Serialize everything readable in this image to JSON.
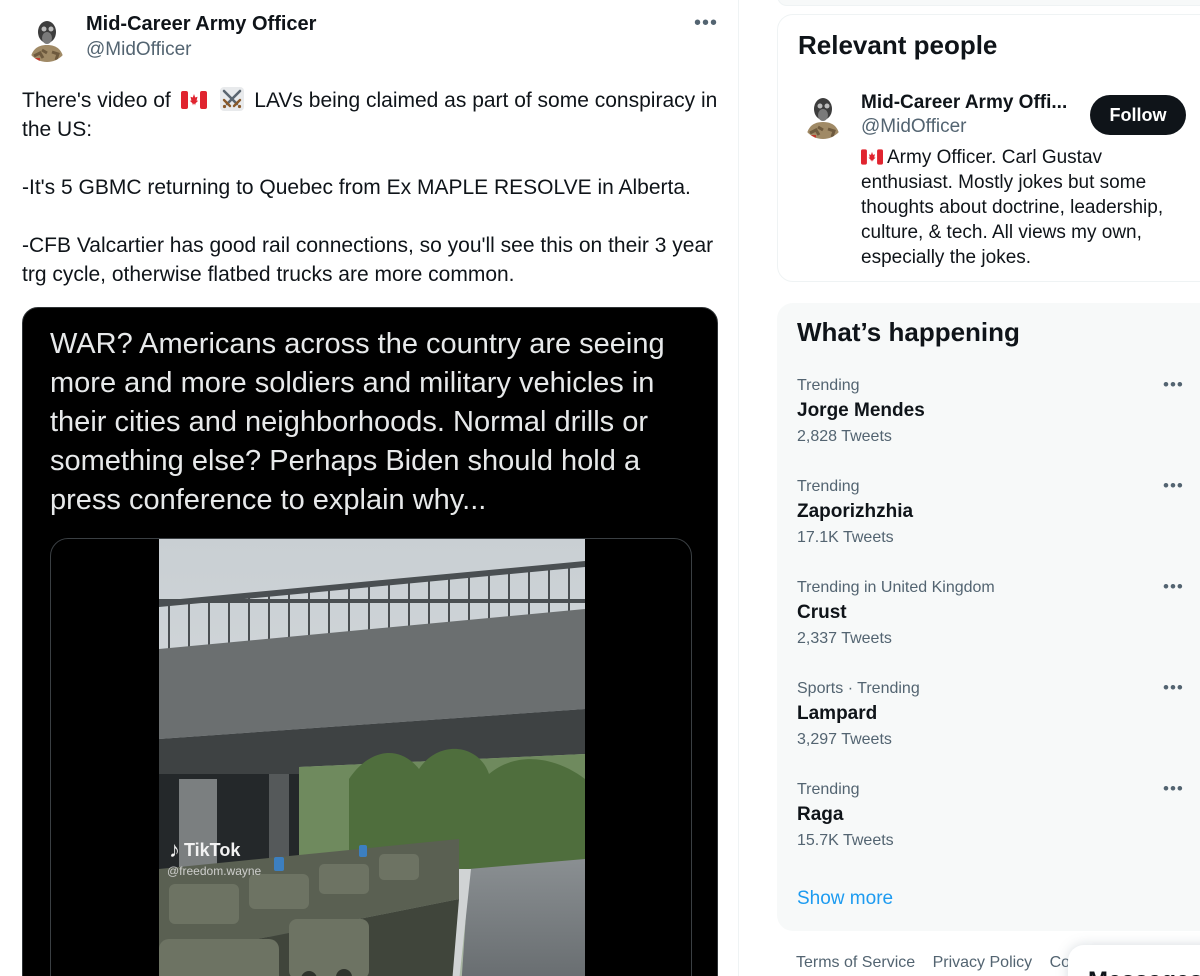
{
  "tweet": {
    "author_name": "Mid-Career Army Officer",
    "author_handle": "@MidOfficer",
    "more_label": "•••",
    "text_before_emoji": "There's video of",
    "text_after_emoji": "LAVs being claimed as part of some conspiracy in the US:",
    "paragraph_2": "-It's 5 GBMC returning to Quebec from Ex MAPLE RESOLVE in Alberta.",
    "paragraph_3": "-CFB Valcartier has good rail connections, so you'll see this on their 3 year trg cycle, otherwise flatbed trucks are more common.",
    "emojis": [
      "canada-flag",
      "crossed-swords"
    ],
    "media": {
      "caption": "WAR? Americans across the country are seeing more and more soldiers and military vehicles in their cities and neighborhoods. Normal drills or something else? Perhaps Biden should hold a press conference to explain why...",
      "video_watermark": "TikTok",
      "video_user": "@freedom.wayne"
    }
  },
  "relevant_people": {
    "title": "Relevant people",
    "person": {
      "name": "Mid-Career Army Offi...",
      "handle": "@MidOfficer",
      "follow_label": "Follow",
      "bio": "Army Officer. Carl Gustav enthusiast. Mostly jokes but some thoughts about doctrine, leadership, culture, & tech. All views my own, especially the jokes."
    }
  },
  "whats_happening": {
    "title": "What’s happening",
    "trends": [
      {
        "context": "Trending",
        "name": "Jorge Mendes",
        "count": "2,828 Tweets"
      },
      {
        "context": "Trending",
        "name": "Zaporizhzhia",
        "count": "17.1K Tweets"
      },
      {
        "context": "Trending in United Kingdom",
        "name": "Crust",
        "count": "2,337 Tweets"
      },
      {
        "context": "Sports · Trending",
        "name": "Lampard",
        "count": "3,297 Tweets"
      },
      {
        "context": "Trending",
        "name": "Raga",
        "count": "15.7K Tweets"
      }
    ],
    "more_label": "•••",
    "show_more": "Show more"
  },
  "footer": {
    "links": [
      "Terms of Service",
      "Privacy Policy",
      "Co"
    ]
  },
  "messages": {
    "title": "Messages"
  },
  "colors": {
    "accent": "#1d9bf0",
    "text_primary": "#0f1419",
    "text_secondary": "#536471",
    "follow_bg": "#0f1419",
    "card_bg": "#f7f9f9"
  }
}
